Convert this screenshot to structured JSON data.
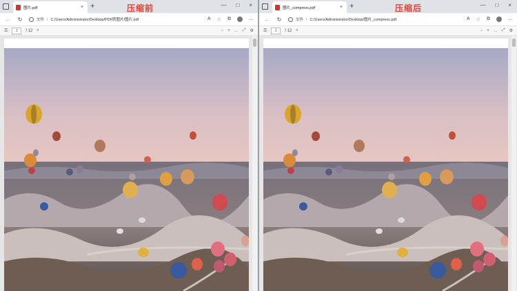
{
  "labels": {
    "before": "压缩前",
    "after": "压缩后"
  },
  "left_window": {
    "tab_title": "图片.pdf",
    "file_tag": "文件",
    "url": "C:/Users/Administrator/Desktop/PDF转图片/图片.pdf",
    "page_current": "1",
    "page_total": "/ 12"
  },
  "right_window": {
    "tab_title": "图片_compress.pdf",
    "file_tag": "文件",
    "url": "C:/Users/Administrator/Desktop/图片_compress.pdf",
    "page_current": "1",
    "page_total": "/ 12"
  },
  "icons": {
    "close": "×",
    "new_tab": "+",
    "minimize": "—",
    "maximize": "□",
    "back": "←",
    "refresh": "↻",
    "zoom_out": "−",
    "zoom_in": "+",
    "more": "…",
    "fullscreen": "⤢",
    "settings": "⚙",
    "search": "⌕",
    "contents": "☰"
  },
  "colors": {
    "label": "#e8412f",
    "pdf_icon": "#d93025"
  }
}
